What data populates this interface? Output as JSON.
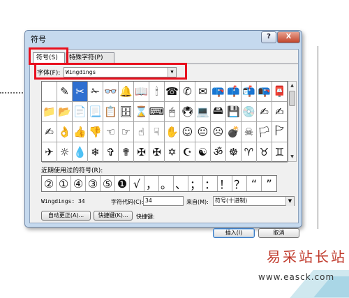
{
  "dialog": {
    "title": "符号",
    "help_button": "?",
    "close_button": "X"
  },
  "tabs": [
    {
      "label": "符号(S)"
    },
    {
      "label": "特殊字符(P)"
    }
  ],
  "font": {
    "label": "字体(F):",
    "value": "Wingdings"
  },
  "symbol_grid": [
    "",
    "✎",
    "✂",
    "✁",
    "👓",
    "🔔",
    "📖",
    "🕯",
    "☎",
    "✆",
    "✉",
    "📪",
    "📫",
    "📬",
    "📭",
    "📮",
    "📁",
    "📂",
    "📄",
    "📃",
    "📋",
    "🗄",
    "⌛",
    "⌨",
    "🖱",
    "🖲",
    "💻",
    "🖴",
    "💾",
    "💿",
    "✍",
    "✍",
    "✍",
    "👌",
    "👍",
    "👎",
    "☜",
    "☞",
    "☝",
    "☟",
    "✋",
    "☺",
    "😐",
    "☹",
    "💣",
    "☠",
    "🏳",
    "🏱",
    "✈",
    "☼",
    "💧",
    "❄",
    "✞",
    "✟",
    "✠",
    "✠",
    "✡",
    "☪",
    "☯",
    "ॐ",
    "☸",
    "♈",
    "♉",
    "♊"
  ],
  "recent": {
    "label": "近期使用过的符号(R):",
    "symbols": [
      "②",
      "①",
      "④",
      "③",
      "⑤",
      "❶",
      "√",
      "，",
      "。",
      "、",
      "；",
      "：",
      "！",
      "？",
      "“",
      "”"
    ]
  },
  "info": {
    "font_name": "Wingdings: 34",
    "char_code_label": "字符代码(C):",
    "char_code": "34",
    "from_label": "来自(M):",
    "from_value": "符号(十进制)"
  },
  "buttons": {
    "autocorrect": "自动更正(A)...",
    "shortcut_key": "快捷键(K)...",
    "shortcut_label": "快捷键:",
    "insert": "插入(I)",
    "cancel": "取消"
  },
  "watermark": {
    "site": "易采站长站",
    "url": "www.easck.com"
  }
}
